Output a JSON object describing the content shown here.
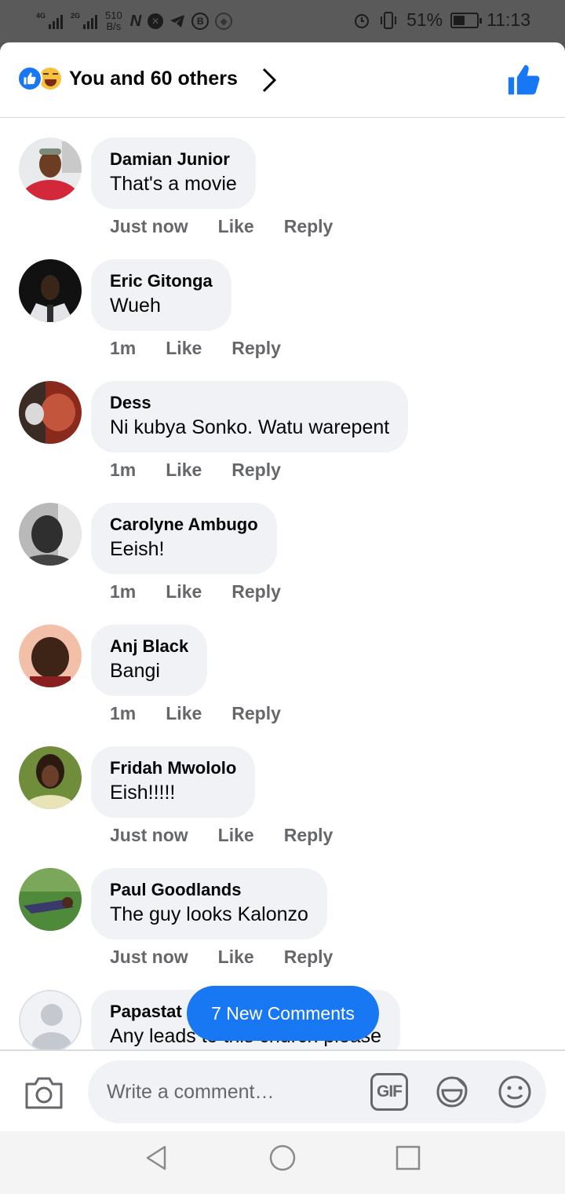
{
  "status_bar": {
    "net1": "4G",
    "net2": "2G",
    "speed_value": "510",
    "speed_unit": "B/s",
    "app_n": "N",
    "battery_percent": "51%",
    "battery_level": 0.51,
    "time": "11:13",
    "icons": [
      "signal-icon",
      "signal-icon",
      "n-icon",
      "x-circle-icon",
      "telegram-icon",
      "b-icon",
      "shield-icon",
      "alarm-icon",
      "vibrate-icon",
      "battery-icon"
    ]
  },
  "header": {
    "reactions": [
      "like-reaction-icon",
      "haha-reaction-icon"
    ],
    "title": "You and 60 others",
    "accent": "#1877f2"
  },
  "comments": [
    {
      "name": "Damian Junior",
      "text": "That's a movie",
      "time": "Just now",
      "like": "Like",
      "reply": "Reply",
      "avatar_color": "#d3283a"
    },
    {
      "name": "Eric Gitonga",
      "text": "Wueh",
      "time": "1m",
      "like": "Like",
      "reply": "Reply",
      "avatar_color": "#2b2b2b"
    },
    {
      "name": "Dess",
      "text": "Ni kubya Sonko. Watu warepent",
      "time": "1m",
      "like": "Like",
      "reply": "Reply",
      "avatar_color": "#b2432a"
    },
    {
      "name": "Carolyne Ambugo",
      "text": "Eeish!",
      "time": "1m",
      "like": "Like",
      "reply": "Reply",
      "avatar_color": "#5b5b5b"
    },
    {
      "name": "Anj Black",
      "text": "Bangi",
      "time": "1m",
      "like": "Like",
      "reply": "Reply",
      "avatar_color": "#c98e6c"
    },
    {
      "name": "Fridah Mwololo",
      "text": "Eish!!!!!",
      "time": "Just now",
      "like": "Like",
      "reply": "Reply",
      "avatar_color": "#6f8d3a"
    },
    {
      "name": "Paul Goodlands",
      "text": "The guy looks Kalonzo",
      "time": "Just now",
      "like": "Like",
      "reply": "Reply",
      "avatar_color": "#4f8a3a"
    },
    {
      "name": "Papastat",
      "text": "Any leads to this church please",
      "time": "",
      "like": "",
      "reply": "",
      "avatar_color": "#dcdfe4"
    }
  ],
  "new_comments_label": "7 New Comments",
  "composer": {
    "placeholder": "Write a comment…",
    "gif_label": "GIF"
  },
  "colors": {
    "bubble": "#f0f2f5",
    "meta_text": "#65676b",
    "brand": "#1877f2"
  }
}
